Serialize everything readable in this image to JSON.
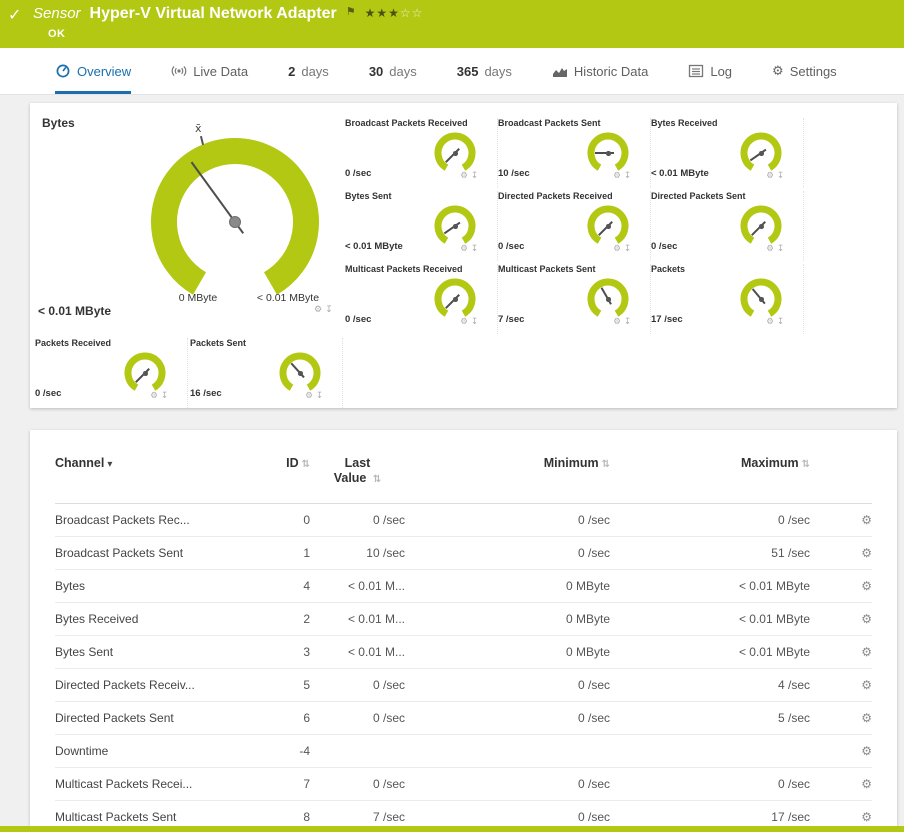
{
  "colors": {
    "brand_green": "#b2c813",
    "tab_active_blue": "#1a6fae",
    "needle_gray": "#4d4d4d"
  },
  "icons": {
    "check": "✓",
    "flag": "⚑",
    "gear": "⚙",
    "download": "↧",
    "row_settings": "⚙"
  },
  "header": {
    "kind_label": "Sensor",
    "title": "Hyper-V Virtual Network Adapter",
    "stars_filled": "★★★",
    "stars_empty": "☆☆",
    "status": "OK"
  },
  "tabs": [
    {
      "label": "Overview"
    },
    {
      "label": "Live Data"
    },
    {
      "num": "2",
      "label": "days"
    },
    {
      "num": "30",
      "label": "days"
    },
    {
      "num": "365",
      "label": "days"
    },
    {
      "label": "Historic Data"
    },
    {
      "label": "Log"
    },
    {
      "label": "Settings"
    }
  ],
  "gauges": {
    "panel_title": "Bytes",
    "main": {
      "value": "< 0.01 MByte",
      "min_label": "0 MByte",
      "max_label": "< 0.01 MByte",
      "avg_marker": "x̄",
      "needle_deg": -36
    },
    "small": [
      {
        "title": "Broadcast Packets Received",
        "value": "0 /sec",
        "needle_deg": -135
      },
      {
        "title": "Broadcast Packets Sent",
        "value": "10 /sec",
        "needle_deg": -90
      },
      {
        "title": "Bytes Received",
        "value": "< 0.01 MByte",
        "needle_deg": -125
      },
      {
        "title": "Bytes Sent",
        "value": "< 0.01 MByte",
        "needle_deg": -125
      },
      {
        "title": "Directed Packets Received",
        "value": "0 /sec",
        "needle_deg": -135
      },
      {
        "title": "Directed Packets Sent",
        "value": "0 /sec",
        "needle_deg": -135
      },
      {
        "title": "Multicast Packets Received",
        "value": "0 /sec",
        "needle_deg": -135
      },
      {
        "title": "Multicast Packets Sent",
        "value": "7 /sec",
        "needle_deg": -30
      },
      {
        "title": "Packets",
        "value": "17 /sec",
        "needle_deg": -40
      },
      {
        "title": "Packets Received",
        "value": "0 /sec",
        "needle_deg": -135
      },
      {
        "title": "Packets Sent",
        "value": "16 /sec",
        "needle_deg": -42
      }
    ]
  },
  "table": {
    "sort_indicator": "▾",
    "sort_arrows": "⇅",
    "columns": [
      {
        "label": "Channel"
      },
      {
        "label": "ID"
      },
      {
        "label": "Last Value"
      },
      {
        "label": "Minimum"
      },
      {
        "label": "Maximum"
      }
    ],
    "rows": [
      {
        "channel": "Broadcast Packets Rec...",
        "id": "0",
        "last": "0 /sec",
        "min": "0 /sec",
        "max": "0 /sec"
      },
      {
        "channel": "Broadcast Packets Sent",
        "id": "1",
        "last": "10 /sec",
        "min": "0 /sec",
        "max": "51 /sec"
      },
      {
        "channel": "Bytes",
        "id": "4",
        "last": "< 0.01 M...",
        "min": "0 MByte",
        "max": "< 0.01 MByte"
      },
      {
        "channel": "Bytes Received",
        "id": "2",
        "last": "< 0.01 M...",
        "min": "0 MByte",
        "max": "< 0.01 MByte"
      },
      {
        "channel": "Bytes Sent",
        "id": "3",
        "last": "< 0.01 M...",
        "min": "0 MByte",
        "max": "< 0.01 MByte"
      },
      {
        "channel": "Directed Packets Receiv...",
        "id": "5",
        "last": "0 /sec",
        "min": "0 /sec",
        "max": "4 /sec"
      },
      {
        "channel": "Directed Packets Sent",
        "id": "6",
        "last": "0 /sec",
        "min": "0 /sec",
        "max": "5 /sec"
      },
      {
        "channel": "Downtime",
        "id": "-4",
        "last": "",
        "min": "",
        "max": ""
      },
      {
        "channel": "Multicast Packets Recei...",
        "id": "7",
        "last": "0 /sec",
        "min": "0 /sec",
        "max": "0 /sec"
      },
      {
        "channel": "Multicast Packets Sent",
        "id": "8",
        "last": "7 /sec",
        "min": "0 /sec",
        "max": "17 /sec"
      }
    ]
  }
}
